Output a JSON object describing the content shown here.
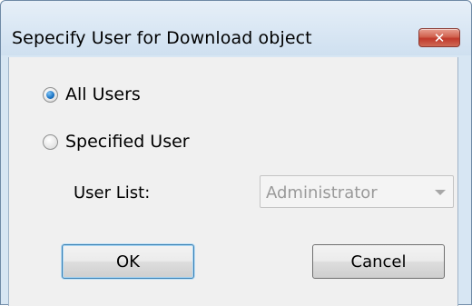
{
  "window": {
    "title": "Sepecify User for Download object",
    "close_label": "✕"
  },
  "options": {
    "all_users_label": "All Users",
    "all_users_selected": true,
    "specified_user_label": "Specified User",
    "specified_user_selected": false
  },
  "user_list": {
    "label": "User List:",
    "value": "Administrator",
    "enabled": false
  },
  "buttons": {
    "ok_label": "OK",
    "cancel_label": "Cancel"
  },
  "colors": {
    "title_bg": "#d7e6f3",
    "client_bg": "#f0f0f0",
    "close_red": "#c0392b",
    "radio_blue": "#1b73c4"
  }
}
